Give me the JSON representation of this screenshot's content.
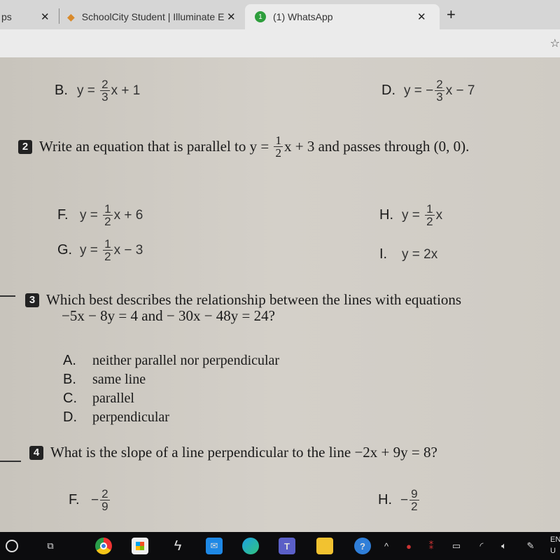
{
  "browser": {
    "tabs": [
      {
        "label": "ps"
      },
      {
        "label": "SchoolCity Student | Illuminate E"
      },
      {
        "label": "(1) WhatsApp",
        "badge": "1"
      }
    ],
    "close_glyph": "✕",
    "new_tab_glyph": "+",
    "bookmark_glyph": "☆"
  },
  "worksheet": {
    "q1_options": [
      {
        "letter": "B.",
        "eq": [
          {
            "t": "y = "
          },
          {
            "n": "2",
            "d": "3"
          },
          {
            "t": "x + 1"
          }
        ]
      },
      {
        "letter": "D.",
        "eq": [
          {
            "t": "y = −"
          },
          {
            "n": "2",
            "d": "3"
          },
          {
            "t": "x − 7"
          }
        ]
      }
    ],
    "q2": {
      "number": "2",
      "text_pre": "Write an equation that is parallel to ",
      "eq": [
        {
          "t": "y = "
        },
        {
          "n": "1",
          "d": "2"
        },
        {
          "t": "x + 3"
        }
      ],
      "text_post": " and passes through (0, 0).",
      "options": [
        {
          "letter": "F.",
          "eq": [
            {
              "t": "y = "
            },
            {
              "n": "1",
              "d": "2"
            },
            {
              "t": "x + 6"
            }
          ]
        },
        {
          "letter": "H.",
          "eq": [
            {
              "t": "y = "
            },
            {
              "n": "1",
              "d": "2"
            },
            {
              "t": "x"
            }
          ]
        },
        {
          "letter": "G.",
          "eq": [
            {
              "t": "y = "
            },
            {
              "n": "1",
              "d": "2"
            },
            {
              "t": "x − 3"
            }
          ]
        },
        {
          "letter": "I.",
          "eq": [
            {
              "t": "y = 2x"
            }
          ]
        }
      ]
    },
    "q3": {
      "number": "3",
      "line1": "Which best describes the relationship between the lines with equations",
      "line2": "−5x − 8y = 4 and − 30x − 48y = 24?",
      "options": [
        {
          "letter": "A.",
          "text": "neither parallel nor perpendicular"
        },
        {
          "letter": "B.",
          "text": "same line"
        },
        {
          "letter": "C.",
          "text": "parallel"
        },
        {
          "letter": "D.",
          "text": "perpendicular"
        }
      ]
    },
    "q4": {
      "number": "4",
      "text": "What is the slope of a line perpendicular to the line −2x + 9y = 8?",
      "options": [
        {
          "letter": "F.",
          "eq": [
            {
              "t": "−"
            },
            {
              "n": "2",
              "d": "9"
            }
          ]
        },
        {
          "letter": "H.",
          "eq": [
            {
              "t": "−"
            },
            {
              "n": "9",
              "d": "2"
            }
          ]
        }
      ]
    }
  },
  "taskbar": {
    "icons": [
      "search-circle",
      "task-view",
      "chrome",
      "store",
      "bolt-app",
      "mail",
      "edge",
      "teams",
      "file-explorer",
      "help"
    ],
    "tray_text": "EN",
    "tray_sub": "U",
    "chevron": "^"
  }
}
